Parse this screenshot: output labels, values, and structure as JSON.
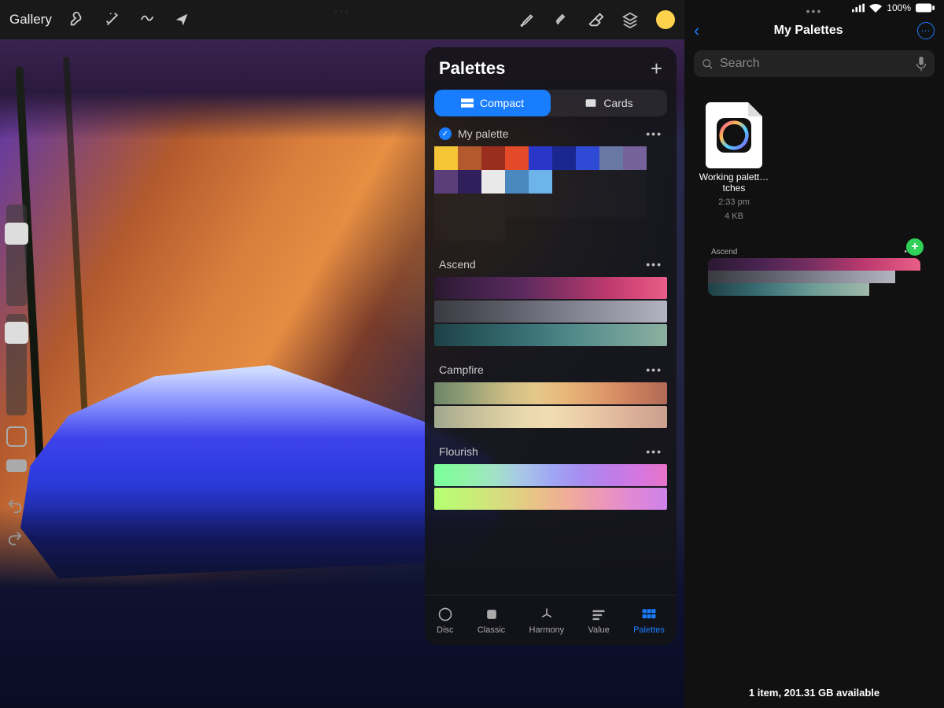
{
  "procreate": {
    "gallery_label": "Gallery",
    "drag_handle": "•••",
    "current_color": "#ffd24d",
    "palettes_panel": {
      "title": "Palettes",
      "segments": {
        "compact": "Compact",
        "cards": "Cards"
      },
      "footer_tabs": [
        {
          "key": "disc",
          "label": "Disc"
        },
        {
          "key": "classic",
          "label": "Classic"
        },
        {
          "key": "harmony",
          "label": "Harmony"
        },
        {
          "key": "value",
          "label": "Value"
        },
        {
          "key": "palettes",
          "label": "Palettes",
          "active": true
        }
      ],
      "palettes": [
        {
          "name": "My palette",
          "selected": true,
          "swatches": [
            "#f4c536",
            "#b25a2e",
            "#9a2e1e",
            "#e34a2a",
            "#2a36c7",
            "#1c2690",
            "#2f4bd6",
            "#6a78a6",
            "#76629a",
            "#5a3e7a",
            "#2f1f5a",
            "#e9e9e9",
            "#4a88c0",
            "#6db4ea"
          ]
        },
        {
          "name": "Ascend",
          "gradients": [
            "linear-gradient(90deg,#2a1830,#3a2042,#4a2452,#5c2a5e,#7a2f62,#9c3468,#bf3a6e,#d64a7a,#e85f88)",
            "linear-gradient(90deg,#3a3a42,#4c4c56,#60606c,#757584,#8a8a98,#9f9fac,#b4b4c0)",
            "linear-gradient(90deg,#1e4046,#2a5a5e,#3a7076,#528a8a,#6e9e96,#8cb0a0)"
          ]
        },
        {
          "name": "Campfire",
          "gradients": [
            "linear-gradient(90deg,#6e8668,#8a9a74,#b0ae7c,#d2c086,#e6c88a,#e8b87a,#e2a470,#d88e64,#c67a5c,#b06a56)",
            "linear-gradient(90deg,#a0a88e,#bcb896,#d4c8a0,#e8d8ac,#f0dcb0,#ecceaa,#e4bea0,#d8ac96,#caa08e)"
          ]
        },
        {
          "name": "Flourish",
          "gradients": [
            "linear-gradient(90deg,#7aff9a,#8ef4a4,#a0e4c4,#a8c6e8,#a0a8f4,#a68ef0,#bc7eea,#d476e0,#e874c8)",
            "linear-gradient(90deg,#b4ff72,#c6f078,#d8dc7e,#e8c486,#f0ac98,#ec98b8,#e088d6,#ce82ea)"
          ]
        }
      ]
    }
  },
  "files": {
    "status": {
      "signal": "􀙇",
      "battery_pct": "100%"
    },
    "drag_handle": "•••",
    "nav_title": "My Palettes",
    "search_placeholder": "Search",
    "items": [
      {
        "name": "Working palett…tches",
        "time": "2:33 pm",
        "size": "4 KB"
      }
    ],
    "import_preview": {
      "name": "Ascend",
      "gradients": [
        "linear-gradient(90deg,#2a1830,#4a2452,#7a2f62,#bf3a6e,#e85f88)",
        "linear-gradient(90deg,#3a3a42,#60606c,#8a8a98,#b4b4c0)",
        "linear-gradient(90deg,#1e4046,#3a7076,#6e9e96,#a0b8aa)"
      ]
    },
    "footer": "1 item, 201.31 GB available"
  }
}
